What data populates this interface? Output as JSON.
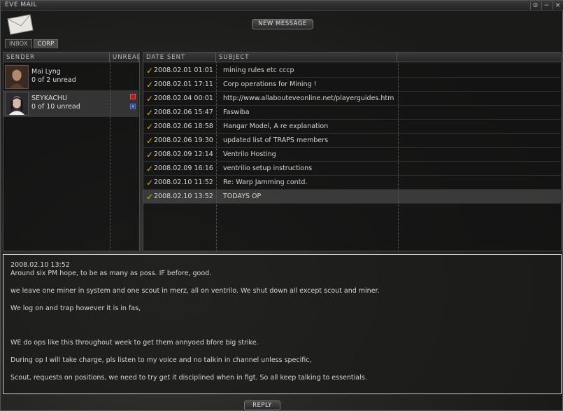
{
  "window": {
    "title": "EVE MAIL",
    "controls": [
      "⊙",
      "−",
      "×"
    ]
  },
  "header": {
    "new_message_label": "NEW MESSAGE",
    "tabs": [
      {
        "label": "INBOX",
        "active": false
      },
      {
        "label": "CORP",
        "active": true
      }
    ]
  },
  "senders": {
    "columns": [
      "SENDER",
      "UNREAD"
    ],
    "items": [
      {
        "name": "Mai Lyng",
        "unread": "0 of 2 unread",
        "selected": false
      },
      {
        "name": "SEYKACHU",
        "unread": "0 of 10 unread",
        "selected": true
      }
    ]
  },
  "messages": {
    "columns": [
      "DATE SENT",
      "SUBJECT"
    ],
    "rows": [
      {
        "date": "2008.02.01 01:01",
        "subject": "mining rules etc cccp"
      },
      {
        "date": "2008.02.01 17:11",
        "subject": "Corp operations for Mining !"
      },
      {
        "date": "2008.02.04 00:01",
        "subject": "http://www.allabouteveonline.net/playerguides.htm"
      },
      {
        "date": "2008.02.06 15:47",
        "subject": "Faswiba"
      },
      {
        "date": "2008.02.06 18:58",
        "subject": "Hangar Model, A re explanation"
      },
      {
        "date": "2008.02.06 19:30",
        "subject": "updated list of TRAPS members"
      },
      {
        "date": "2008.02.09 12:14",
        "subject": "Ventrilo Hosting"
      },
      {
        "date": "2008.02.09 16:16",
        "subject": "ventrilio setup instructions"
      },
      {
        "date": "2008.02.10 11:52",
        "subject": "Re: Warp Jamming contd."
      },
      {
        "date": "2008.02.10 13:52",
        "subject": "TODAYS OP"
      }
    ]
  },
  "body": {
    "date": "2008.02.10 13:52",
    "lines": [
      "Around six PM hope, to be as many as poss. IF before, good.",
      "we leave one miner in system and one scout in merz, all on ventrilo. We shut down all except scout and miner.",
      "We log on and trap however it is in fas,",
      "WE do ops like this throughout week to get them annyoed bfore big strike.",
      "During op I will take charge, pls listen to my voice and no talkin in channel unless specific,",
      "Scout, requests on positions, we need to try get it disciplined when in figt. So all keep talking to essentials."
    ]
  },
  "footer": {
    "reply_label": "REPLY"
  },
  "colors": {
    "check": "#e0b030",
    "flag": "#b02020",
    "plus": "#2a3a8a"
  }
}
